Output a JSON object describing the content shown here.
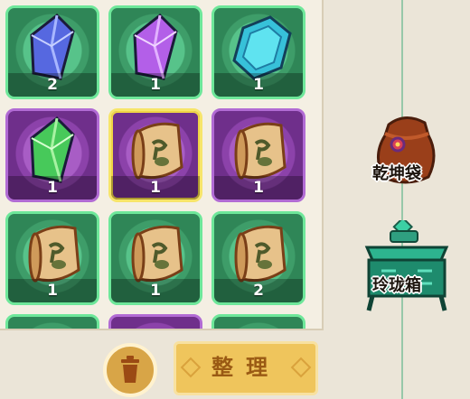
{
  "inventory": {
    "slots": [
      {
        "item": "blue-crystal",
        "count": "2",
        "frame": "green",
        "selected": false
      },
      {
        "item": "purple-crystal",
        "count": "1",
        "frame": "green",
        "selected": false
      },
      {
        "item": "cyan-crystal",
        "count": "1",
        "frame": "green",
        "selected": false
      },
      {
        "item": "green-crystal",
        "count": "1",
        "frame": "purple",
        "selected": false
      },
      {
        "item": "scroll",
        "count": "1",
        "frame": "purple",
        "selected": true
      },
      {
        "item": "scroll",
        "count": "1",
        "frame": "purple",
        "selected": false
      },
      {
        "item": "scroll",
        "count": "1",
        "frame": "green",
        "selected": false
      },
      {
        "item": "scroll",
        "count": "1",
        "frame": "green",
        "selected": false
      },
      {
        "item": "scroll",
        "count": "2",
        "frame": "green",
        "selected": false
      },
      {
        "item": "",
        "count": "",
        "frame": "green",
        "selected": false
      },
      {
        "item": "",
        "count": "",
        "frame": "purple",
        "selected": false
      },
      {
        "item": "",
        "count": "",
        "frame": "green",
        "selected": false
      }
    ]
  },
  "side": {
    "bag_label": "乾坤袋",
    "chest_label": "玲珑箱"
  },
  "actions": {
    "trash_icon": "trash-can-icon",
    "sort_label": "整理"
  },
  "colors": {
    "green_frame": "#6ee79a",
    "purple_frame": "#b16bd4",
    "selected_frame": "#f7e56a",
    "button_gold": "#efc55c"
  }
}
